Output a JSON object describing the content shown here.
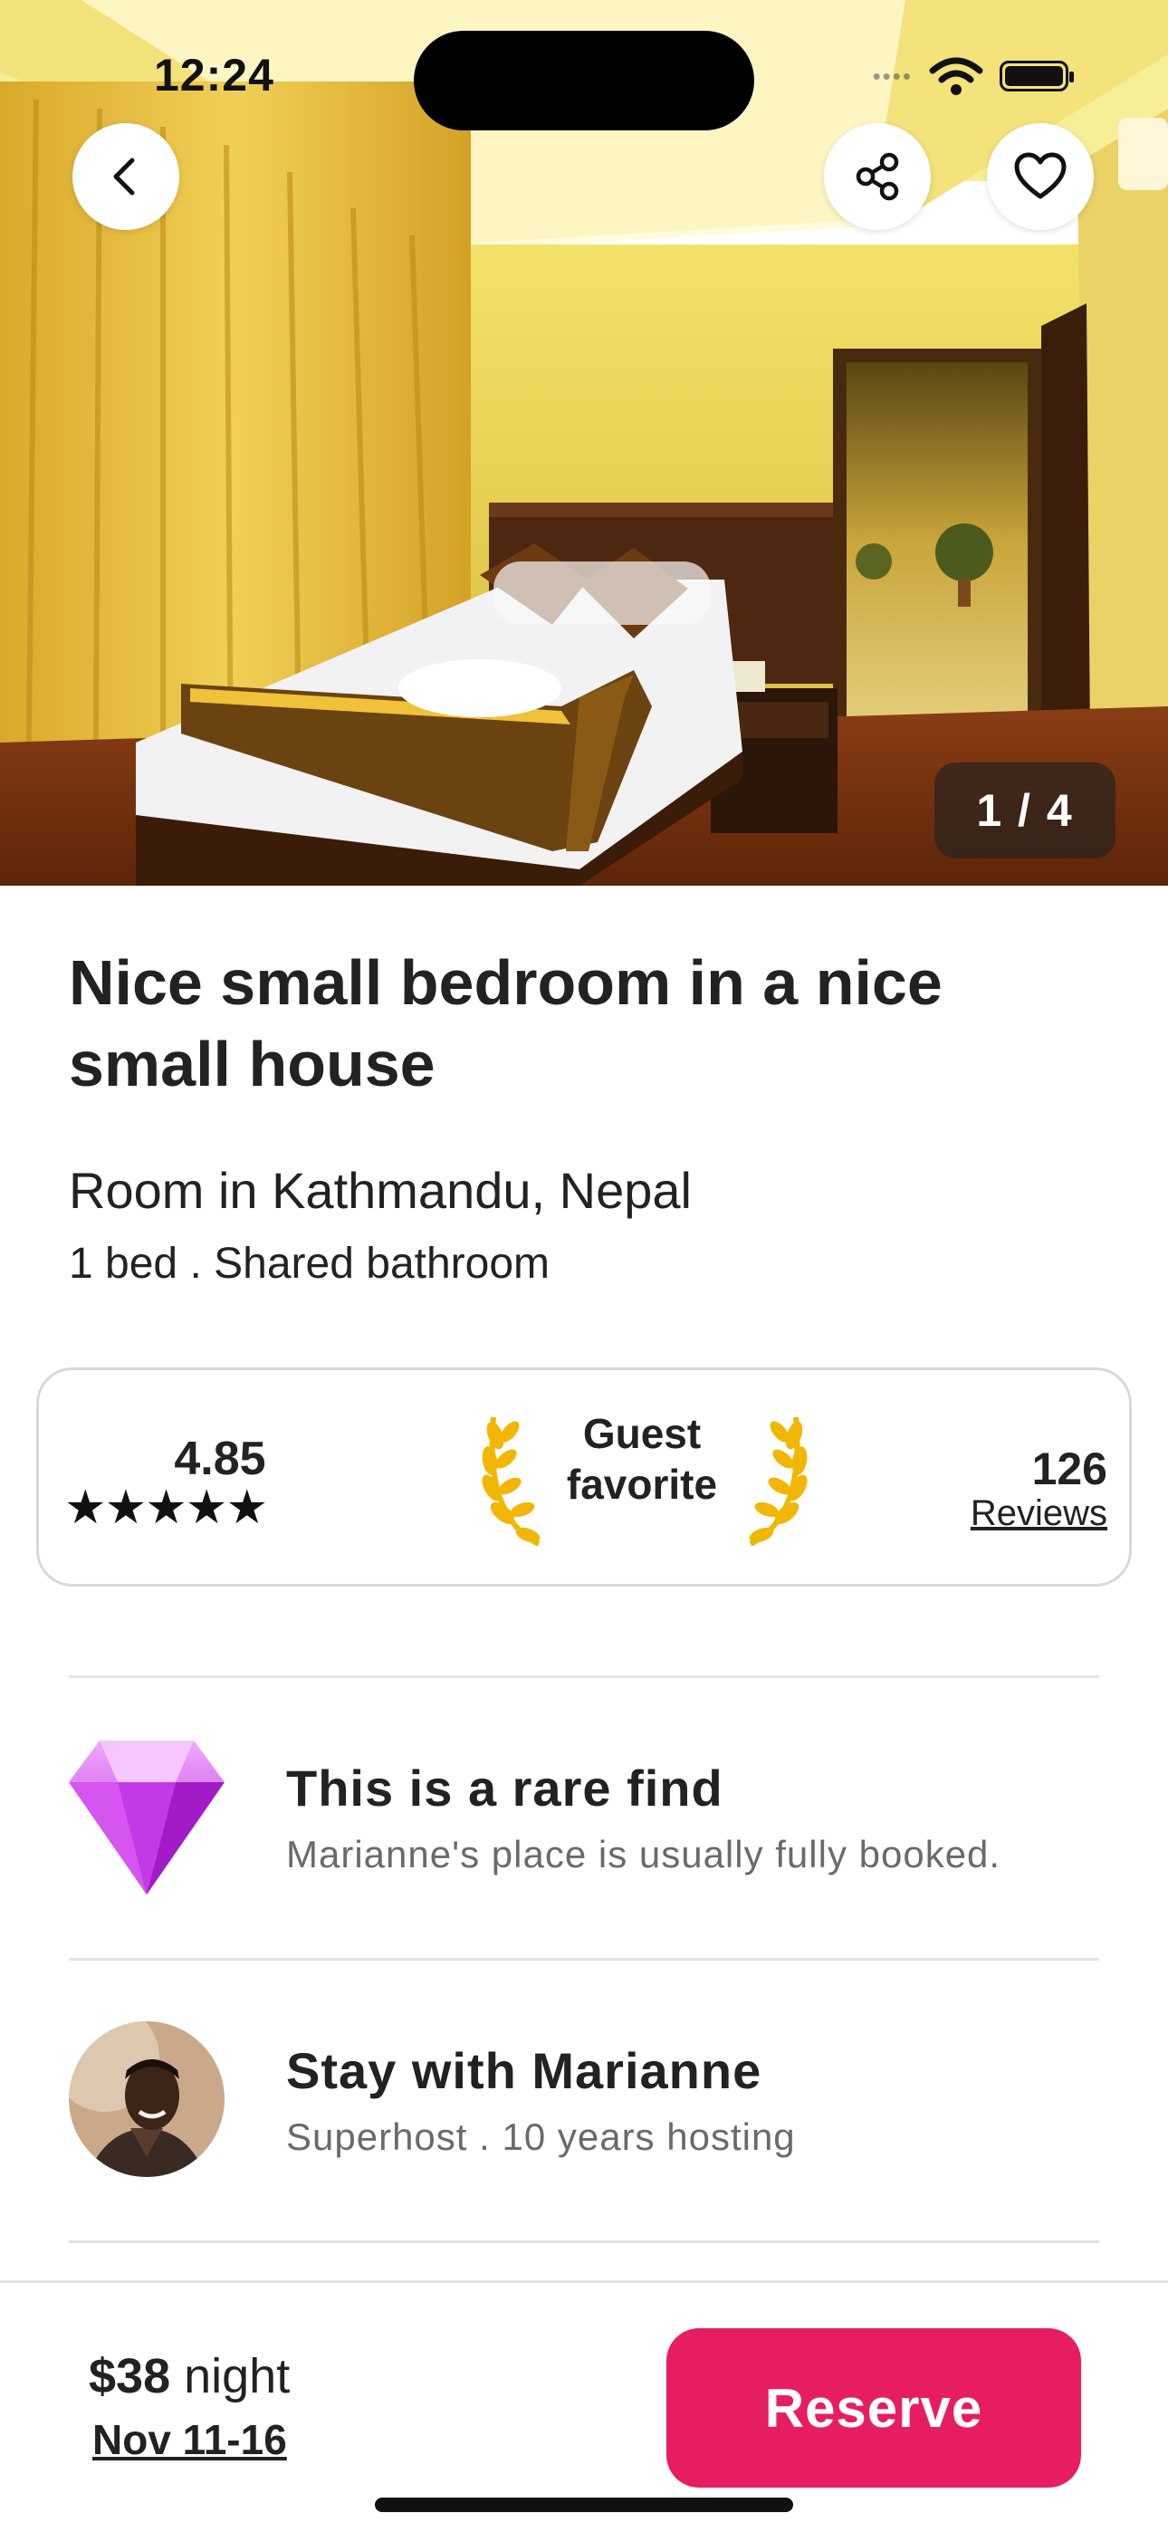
{
  "status_bar": {
    "time": "12:24"
  },
  "hero": {
    "photo_counter": "1 / 4",
    "back_icon": "chevron-left-icon",
    "share_icon": "share-icon",
    "favorite_icon": "heart-icon"
  },
  "listing": {
    "title": "Nice small bedroom in a nice small house",
    "location": "Room in Kathmandu, Nepal",
    "details": "1 bed . Shared bathroom"
  },
  "rating_card": {
    "rating": "4.85",
    "stars": "★★★★★",
    "badge_line1": "Guest",
    "badge_line2": "favorite",
    "review_count": "126",
    "reviews_label": "Reviews"
  },
  "highlights": [
    {
      "title": "This is a rare find",
      "subtitle": "Marianne's place is usually fully booked.",
      "icon": "diamond-icon"
    },
    {
      "title": "Stay with Marianne",
      "subtitle": "Superhost . 10 years hosting",
      "icon": "host-avatar"
    }
  ],
  "booking": {
    "price": "$38",
    "unit": " night",
    "dates": "Nov 11-16",
    "reserve_label": "Reserve"
  },
  "colors": {
    "accent": "#e61e60",
    "divider": "#e4e4e4",
    "laurel": "#f2b705",
    "diamond": "#c43ee6"
  }
}
